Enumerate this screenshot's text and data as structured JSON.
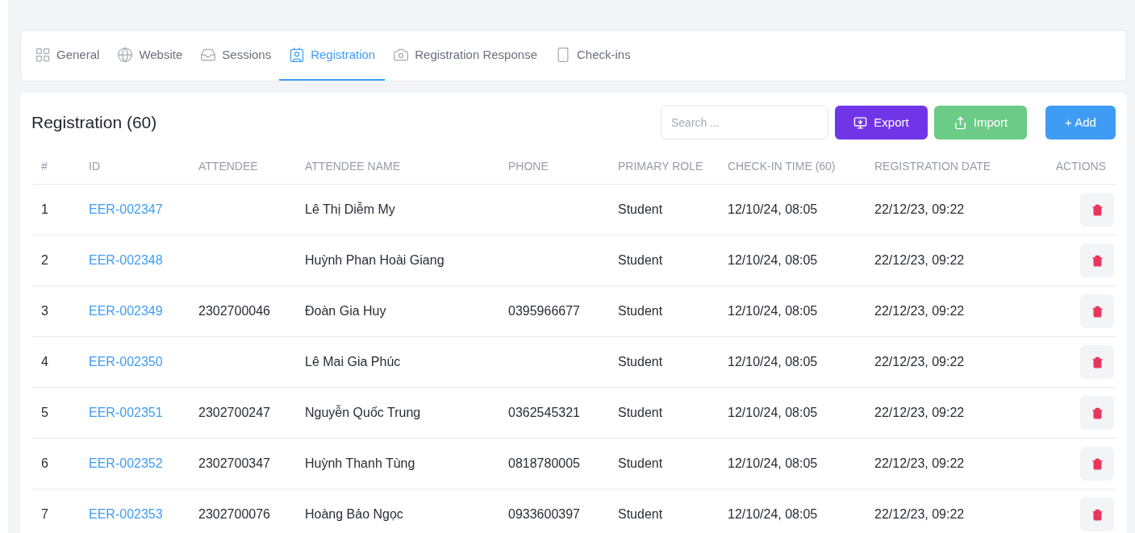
{
  "tabs": [
    {
      "label": "General",
      "kind": "dots",
      "selected": false
    },
    {
      "label": "Website",
      "kind": "globe",
      "selected": false
    },
    {
      "label": "Sessions",
      "kind": "tray",
      "selected": false
    },
    {
      "label": "Registration",
      "kind": "badge",
      "selected": true
    },
    {
      "label": "Registration Response",
      "kind": "camera",
      "selected": false
    },
    {
      "label": "Check-ins",
      "kind": "phone",
      "selected": false
    }
  ],
  "title": "Registration (60)",
  "search": {
    "placeholder": "Search ..."
  },
  "buttons": [
    {
      "label": "Export",
      "kind": "export"
    },
    {
      "label": "Import",
      "kind": "import"
    },
    {
      "label": "+ Add",
      "kind": "add"
    }
  ],
  "table": {
    "columns": [
      "#",
      "ID",
      "ATTENDEE",
      "ATTENDEE NAME",
      "PHONE",
      "PRIMARY ROLE",
      "CHECK-IN TIME (60)",
      "REGISTRATION DATE",
      "ACTIONS"
    ],
    "rows": [
      [
        "1",
        "EER-002347",
        "",
        "Lê Thị Diễm My",
        "",
        "Student",
        "12/10/24, 08:05",
        "22/12/23, 09:22"
      ],
      [
        "2",
        "EER-002348",
        "",
        "Huỳnh Phan Hoài Giang",
        "",
        "Student",
        "12/10/24, 08:05",
        "22/12/23, 09:22"
      ],
      [
        "3",
        "EER-002349",
        "2302700046",
        "Đoàn Gia Huy",
        "0395966677",
        "Student",
        "12/10/24, 08:05",
        "22/12/23, 09:22"
      ],
      [
        "4",
        "EER-002350",
        "",
        "Lê Mai Gia Phúc",
        "",
        "Student",
        "12/10/24, 08:05",
        "22/12/23, 09:22"
      ],
      [
        "5",
        "EER-002351",
        "2302700247",
        "Nguyễn Quốc Trung",
        "0362545321",
        "Student",
        "12/10/24, 08:05",
        "22/12/23, 09:22"
      ],
      [
        "6",
        "EER-002352",
        "2302700347",
        "Huỳnh Thanh Tùng",
        "0818780005",
        "Student",
        "12/10/24, 08:05",
        "22/12/23, 09:22"
      ],
      [
        "7",
        "EER-002353",
        "2302700076",
        "Hoàng Bảo Ngọc",
        "0933600397",
        "Student",
        "12/10/24, 08:05",
        "22/12/23, 09:22"
      ]
    ]
  }
}
